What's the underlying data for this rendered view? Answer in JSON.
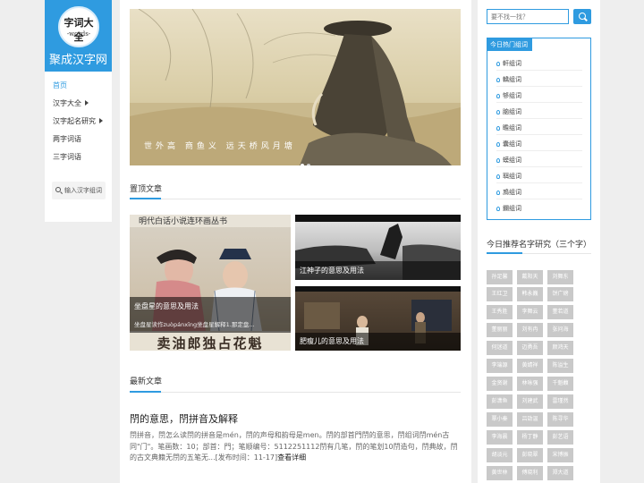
{
  "logo": {
    "circle_main": "字词大全",
    "circle_sub": "-words-",
    "site_name": "聚成汉字网"
  },
  "nav": [
    {
      "label": "首页",
      "active": true,
      "arrow": false
    },
    {
      "label": "汉字大全",
      "active": false,
      "arrow": true
    },
    {
      "label": "汉字起名研究",
      "active": false,
      "arrow": true
    },
    {
      "label": "两字词语",
      "active": false,
      "arrow": false
    },
    {
      "label": "三字词语",
      "active": false,
      "arrow": false
    }
  ],
  "side_search": {
    "label": "输入汉字组词"
  },
  "banner": {
    "caption": "世外高 商鱼义 远天桥风月塘"
  },
  "sticky": {
    "title": "置顶文章",
    "cards": [
      {
        "label": "坐盘星的意思及用法",
        "desc": "坐盘星读作zuòpánxīng坐盘星解释1.那定盘...",
        "image_text": "明代白话小说连环画丛书",
        "image_caption": "卖油郎独占花魁"
      },
      {
        "label": "江神子的意思及用法"
      },
      {
        "label": "肥瘦儿的意思及用法"
      }
    ]
  },
  "latest": {
    "title": "最新文章",
    "article": {
      "title": "閅的意思，閅拼音及解释",
      "body": "閅拼音，閅怎么读閅的拼音是mén，閅的声母和韵母是men。閅的部首門閅的意思，閅组词閅mén古同\"门\"。笔画数：10；部首：門；笔顺编号：5112251112閅有几笔，閅的笔划10閅造句，閅典故，閅的古文典籍无閅的五笔无...[发布时间：11-17]",
      "more": "查看详细"
    }
  },
  "right": {
    "search_placeholder": "要不找一找？",
    "hot_title": "今日热门组词",
    "hot_items": [
      "軒组词",
      "轎组词",
      "够组词",
      "脑组词",
      "瞻组词",
      "囊组词",
      "蟆组词",
      "聑组词",
      "鳭组词",
      "鑭组词"
    ],
    "rec_title": "今日推荐名字研究（三个字）",
    "tags": [
      [
        "孙足馨",
        "戴阳天",
        "刘舞东"
      ],
      [
        "王红卫",
        "韩永巍",
        "饼广磅"
      ],
      [
        "王秀胜",
        "李舞云",
        "董若道"
      ],
      [
        "董丽丽",
        "刘有冉",
        "张问海"
      ],
      [
        "何迷道",
        "迈勇吾",
        "颜鸿天"
      ],
      [
        "李端源",
        "黄婧祥",
        "陈溢生"
      ],
      [
        "金贤谢",
        "林咏强",
        "千魁馥"
      ],
      [
        "彭潇鱼",
        "刘建武",
        "雷瑾然"
      ],
      [
        "覃小秦",
        "吕劭温",
        "陈寻华"
      ],
      [
        "李海晨",
        "杨丁静",
        "彭艺语"
      ],
      [
        "胡淡元",
        "彭晓翠",
        "宋博振"
      ],
      [
        "黄世林",
        "傅晓利",
        "郑大道"
      ]
    ]
  }
}
